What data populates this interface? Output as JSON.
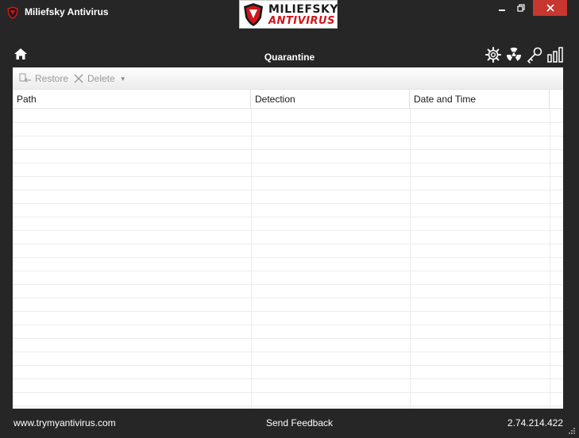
{
  "window": {
    "title": "Miliefsky Antivirus"
  },
  "logo": {
    "line1": "MILIEFSKY",
    "line2": "ANTIVIRUS"
  },
  "nav": {
    "page_title": "Quarantine",
    "icons": [
      "home-icon",
      "gear-icon",
      "radiation-icon",
      "key-icon",
      "bar-chart-icon"
    ]
  },
  "toolbar": {
    "restore_label": "Restore",
    "delete_label": "Delete"
  },
  "table": {
    "columns": [
      "Path",
      "Detection",
      "Date and Time"
    ],
    "rows": []
  },
  "footer": {
    "url": "www.trymyantivirus.com",
    "feedback": "Send Feedback",
    "version": "2.74.214.422"
  },
  "colors": {
    "background": "#262626",
    "close_button": "#c7372f",
    "brand_red": "#d0151c"
  }
}
